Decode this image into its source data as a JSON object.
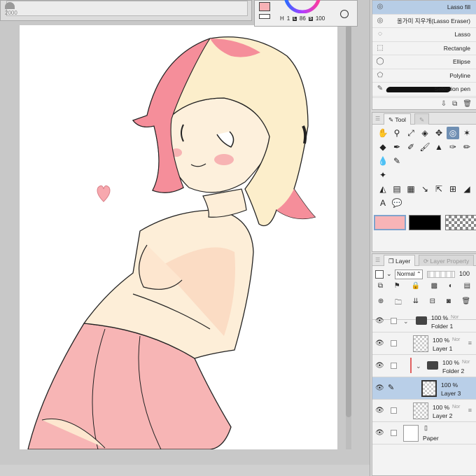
{
  "top_left": {
    "number": "2000"
  },
  "color_panel": {
    "h_label": "H",
    "h": "1",
    "l_label": "L",
    "l": "86",
    "s_label": "S",
    "s": "100"
  },
  "subtools": [
    {
      "label": "Lasso fill",
      "icon": "lasso-fill-icon",
      "active": true
    },
    {
      "label": "올가미 지우개(Lasso Eraser)",
      "icon": "lasso-eraser-icon",
      "active": false
    },
    {
      "label": "Lasso",
      "icon": "lasso-icon",
      "active": false
    },
    {
      "label": "Rectangle",
      "icon": "rectangle-select-icon",
      "active": false
    },
    {
      "label": "Ellipse",
      "icon": "ellipse-select-icon",
      "active": false
    },
    {
      "label": "Polyline",
      "icon": "polyline-select-icon",
      "active": false
    },
    {
      "label": "Selection pen",
      "icon": "selection-pen-icon",
      "active": false
    }
  ],
  "tool_panel": {
    "tab_tool": "Tool"
  },
  "colors": {
    "main": "#f7b4b7",
    "sub": "#000000"
  },
  "layer_panel": {
    "tab_layer": "Layer",
    "tab_property": "Layer Property",
    "blend_mode": "Normal",
    "opacity": "100",
    "layers": [
      {
        "name": "Folder 1",
        "percent": "100 %",
        "mode": "Nor",
        "kind": "folder"
      },
      {
        "name": "Layer 1",
        "percent": "100 %",
        "mode": "Nor",
        "kind": "layer"
      },
      {
        "name": "Folder 2",
        "percent": "100 %",
        "mode": "Nor",
        "kind": "folder"
      },
      {
        "name": "Layer 3",
        "percent": "100 %",
        "mode": "",
        "kind": "layer"
      },
      {
        "name": "Layer 2",
        "percent": "100 %",
        "mode": "Nor",
        "kind": "layer"
      },
      {
        "name": "Paper",
        "percent": "",
        "mode": "",
        "kind": "paper"
      }
    ]
  }
}
